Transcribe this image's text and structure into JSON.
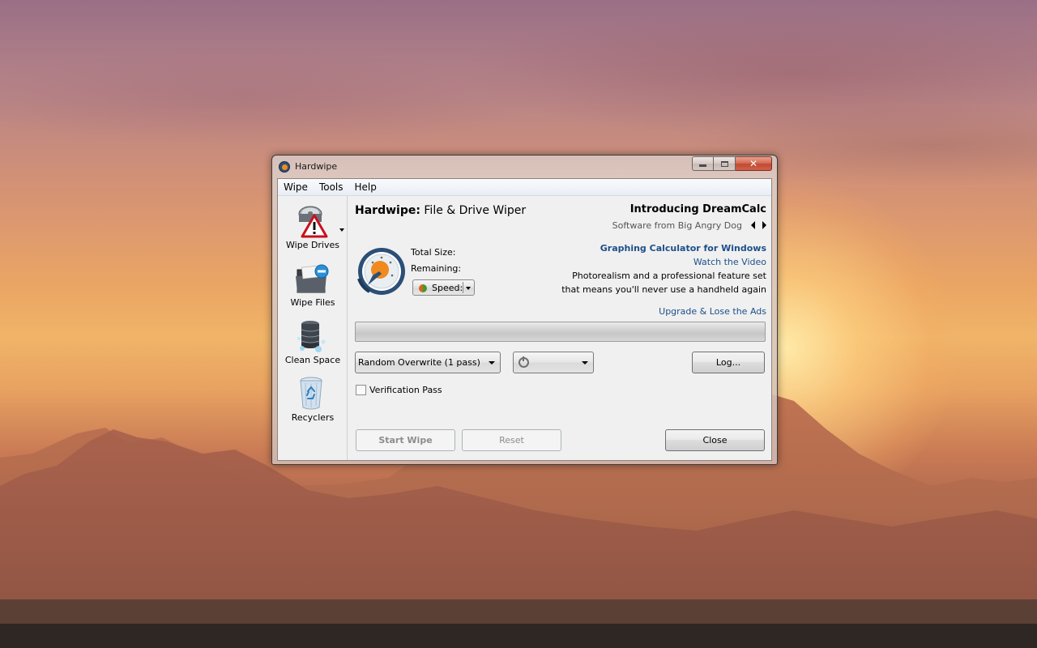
{
  "window": {
    "title": "Hardwipe"
  },
  "menu": {
    "items": [
      "Wipe",
      "Tools",
      "Help"
    ]
  },
  "sidebar": {
    "items": [
      {
        "label": "Wipe Drives",
        "icon": "hard-drive-warning-icon"
      },
      {
        "label": "Wipe Files",
        "icon": "folder-minus-icon"
      },
      {
        "label": "Clean Space",
        "icon": "database-cleanup-icon"
      },
      {
        "label": "Recyclers",
        "icon": "recycle-bin-icon"
      }
    ]
  },
  "header": {
    "app_name": "Hardwipe:",
    "subtitle": "File & Drive Wiper"
  },
  "promo": {
    "title": "Introducing DreamCalc",
    "subtitle": "Software from Big Angry Dog",
    "headline": "Graphing Calculator for Windows",
    "link": "Watch the Video",
    "text_line1": "Photorealism and a professional feature set",
    "text_line2": "that means you'll never use a handheld again",
    "upgrade": "Upgrade & Lose the Ads"
  },
  "stats": {
    "total_size_label": "Total Size:",
    "remaining_label": "Remaining:",
    "speed_label": "Speed:"
  },
  "progress": {
    "value": 0
  },
  "controls": {
    "method_selected": "Random Overwrite (1 pass)",
    "power_selected": "",
    "log_label": "Log...",
    "verification_label": "Verification Pass",
    "verification_checked": false,
    "start_label": "Start Wipe",
    "reset_label": "Reset",
    "close_label": "Close"
  },
  "colors": {
    "link": "#1d4f8a",
    "accent_orange": "#f08a1e",
    "gauge_blue": "#2c4f77",
    "close_red": "#c24a32"
  }
}
